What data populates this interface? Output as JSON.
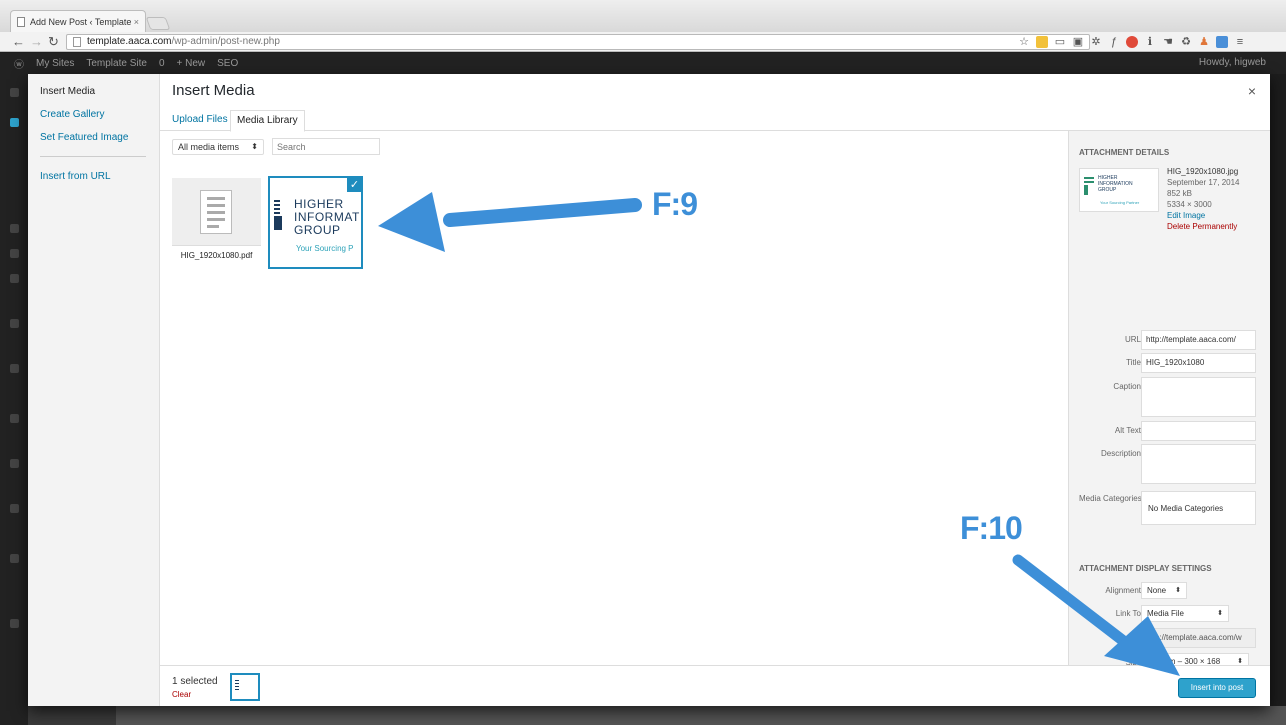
{
  "browser": {
    "tab_title": "Add New Post ‹ Template",
    "url_domain": "template.aaca.com",
    "url_path": "/wp-admin/post-new.php"
  },
  "adminbar": {
    "items": [
      "My Sites",
      "Template Site",
      "0",
      "+ New",
      "SEO"
    ],
    "howdy": "Howdy, higweb"
  },
  "menu": {
    "insert_media": "Insert Media",
    "create_gallery": "Create Gallery",
    "set_featured": "Set Featured Image",
    "insert_url": "Insert from URL"
  },
  "frame": {
    "title": "Insert Media",
    "close": "×",
    "tab_upload": "Upload Files",
    "tab_library": "Media Library"
  },
  "toolbar": {
    "filter_value": "All media items",
    "search_placeholder": "Search"
  },
  "attachments": {
    "pdf_filename": "HIG_1920x1080.pdf",
    "logo_text": "HIGHER\nINFORMAT\nGROUP",
    "logo_tagline": "Your Sourcing P"
  },
  "details": {
    "heading": "Attachment Details",
    "thumb_text": "HIGHER\nINFORMATION\nGROUP",
    "thumb_tag": "Your Sourcing Partner",
    "filename": "HIG_1920x1080.jpg",
    "date": "September 17, 2014",
    "size": "852 kB",
    "dimensions": "5334 × 3000",
    "edit": "Edit Image",
    "delete": "Delete Permanently",
    "url_label": "URL",
    "url_value": "http://template.aaca.com/",
    "title_label": "Title",
    "title_value": "HIG_1920x1080",
    "caption_label": "Caption",
    "alt_label": "Alt Text",
    "description_label": "Description",
    "categories_label": "Media Categories",
    "categories_value": "No Media Categories"
  },
  "display": {
    "heading": "Attachment Display Settings",
    "alignment_label": "Alignment",
    "alignment_value": "None",
    "link_label": "Link To",
    "link_value": "Media File",
    "link_url": "http://template.aaca.com/w",
    "size_label": "Size",
    "size_value": "Medium – 300 × 168"
  },
  "footer": {
    "selected": "1 selected",
    "clear": "Clear",
    "insert": "Insert into post"
  },
  "annotations": {
    "f9": "F:9",
    "f10": "F:10",
    "color": "#3d8fd8"
  }
}
